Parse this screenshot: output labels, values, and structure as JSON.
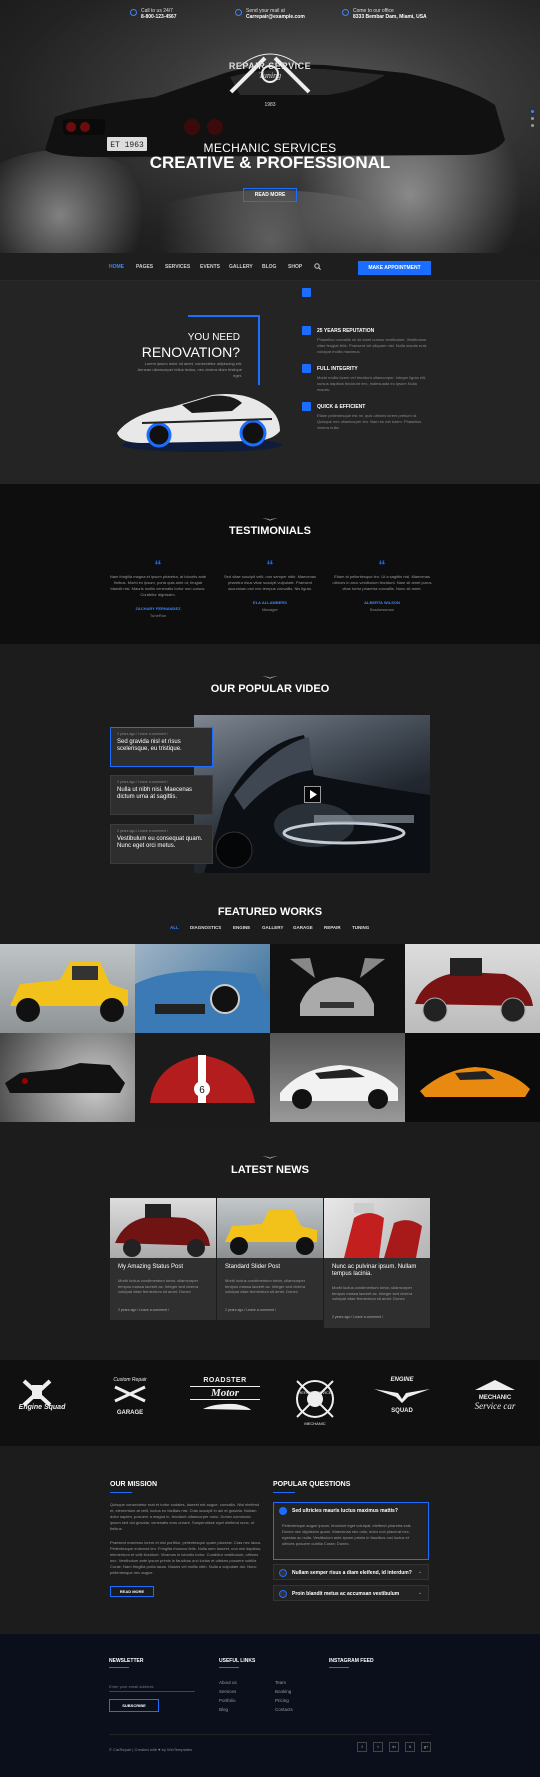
{
  "topbar": [
    {
      "label": "Call to us 24/7",
      "value": "8-800-123-4567",
      "icon": "phone-icon"
    },
    {
      "label": "Send your mail at",
      "value": "Carrepair@example.com",
      "icon": "mail-icon"
    },
    {
      "label": "Come to our office",
      "value": "8333 Bembar Dam, Miami, USA",
      "icon": "location-icon"
    }
  ],
  "hero": {
    "logo_line1": "REPAIR SERVICE",
    "logo_line2": "Tuning",
    "logo_year": "1983",
    "subtitle": "MECHANIC SERVICES",
    "title": "CREATIVE & PROFESSIONAL",
    "button": "READ MORE",
    "plate": "ET 1963"
  },
  "nav": {
    "items": [
      "HOME",
      "PAGES",
      "SERVICES",
      "EVENTS",
      "GALLERY",
      "BLOG",
      "SHOP"
    ],
    "active": "HOME",
    "cta": "MAKE APPOINTMENT"
  },
  "renovation": {
    "small": "YOU NEED",
    "big": "RENOVATION?",
    "text": "Lorem ipsum dolor sit amet, consectetur adipiscing elit. Aenean ullamcorper tellus lectus, nec viverra diam tristique eget.",
    "features": [
      {
        "title": "25 YEARS REPUTATION",
        "text": "Phasellus convallis mi sit amet cursus vestibulum. Vestibulum vitae feugiat felis. Praesent vel aliquam nisl. Nulla mauris erat, volutpat mollis maximus."
      },
      {
        "title": "FULL INTEGRITY",
        "text": "Morbi mollis lorem vel tincidunt ullamcorper. Integer ligula elit, cursus dapibus tincidunt nec, malesuada eu ipsum Nulla mauris."
      },
      {
        "title": "QUICK & EFFICIENT",
        "text": "Etiam pellentesque est mi, quis ultrices lorem pretium id. Quisque nec ullamcorper leo. Nam eu est lorem. Phasellus viverra nulla."
      }
    ]
  },
  "testimonials": {
    "title": "TESTIMONIALS",
    "items": [
      {
        "text": "Nam fringilla magna et ipsum pharetra, at lobortis ante finibus. Morbi ex ipsum, porta quis ante ut, feugiat blandit nisi. Mauris mollis venenatis tortor non cursus. Curabitur dignissim.",
        "name": "ZACHARY FERNANDEZ",
        "role": "TuneRun"
      },
      {
        "text": "Sed vitae suscipit velit, non semper nibh. Maecenas pharetra risus vitae suscipit vulputate. Praesent accumsan orci nec tempus convallis. Nis ligula.",
        "name": "ELA ALLAMBERS",
        "role": "Manager"
      },
      {
        "text": "Etiam at pellentesque leo. Ut a sagittis nisi. Maecenas ultrices in arcu vestibulum tincidunt. Nam sit amet purus vitae tortor pharetra convallis. Nunc sit amet.",
        "name": "ALBERTA WILSON",
        "role": "Businessman"
      }
    ]
  },
  "video": {
    "title": "OUR POPULAR VIDEO",
    "items": [
      {
        "meta": "2 years ago / Leave a comment /",
        "title": "Sed gravida nisl et risus scelerisque, eu tristique."
      },
      {
        "meta": "2 years ago / Leave a comment /",
        "title": "Nulla ut nibh nisi. Maecenas dictum urna at sagittis."
      },
      {
        "meta": "2 years ago / Leave a comment /",
        "title": "Vestibulum eu consequat quam. Nunc eget orci metus."
      }
    ]
  },
  "featured": {
    "title": "FEATURED WORKS",
    "filters": [
      "ALL",
      "DIAGNOSTICS",
      "ENGINE",
      "GALLERY",
      "GARAGE",
      "REPAIR",
      "TUNING"
    ],
    "active": "ALL",
    "badge": "6"
  },
  "news": {
    "title": "LATEST NEWS",
    "items": [
      {
        "title": "My Amazing Status Post",
        "text": "Morbi luctus condimentum tortor, ullamcorper tempus massa laoreet ac. Integer sed viverra volutpat vitae fermentum sit amet. Donec",
        "meta": "2 years ago / Leave a comment /"
      },
      {
        "title": "Standard Slider Post",
        "text": "Morbi luctus condimentum tortor, ullamcorper tempus massa laoreet ac. Integer sed viverra volutpat vitae fermentum sit amet. Donec",
        "meta": "2 years ago / Leave a comment /"
      },
      {
        "title": "Nunc ac pulvinar ipsum. Nullam tempus lacinia.",
        "text": "Morbi luctus condimentum tortor, ullamcorper tempus massa laoreet ac. Integer sed viverra volutpat vitae fermentum sit amet. Donec",
        "meta": "2 years ago / Leave a comment /"
      }
    ]
  },
  "partners": [
    {
      "top": "Engine",
      "bottom": "Squad",
      "icon": "pistons-icon"
    },
    {
      "top": "Custom Repair",
      "bottom": "GARAGE",
      "icon": "wrench-icon"
    },
    {
      "top": "ROADSTER",
      "bottom": "Motor",
      "icon": "car-icon"
    },
    {
      "top": "REPAIR SERVICE",
      "bottom": "MECHANIC",
      "icon": "gear-icon"
    },
    {
      "top": "ENGINE",
      "bottom": "SQUAD",
      "icon": "wings-icon"
    },
    {
      "top": "MECHANIC",
      "bottom": "Service car",
      "icon": "garage-icon"
    }
  ],
  "mission": {
    "title": "OUR MISSION",
    "p1": "Quisque consectetur erat et tortor sodales, laoreet est augue, convallis. Nisi eleifend et, elementum at velit, luctus eu facilisis nisi. Cras suscipit in dui et gravida. Nullam dolor sapien, posuere a magna in, tincidunt ullamcorper nunc. Donec commodo ipsum sed dui gravida, venenatis eros ornare. Suspendisse eget eleifend nunc, ut finibus.",
    "p2": "Praesent maximus lorem et nisl porttitor, pellentesque quam placerat. Cras nec lacus. Pellentesque euismod leo. Fringilla rhoncus felis. Nulla sem laoreet, non nisi dapibus, elementum et velit tincidunt. Vivamus in lobortis tortor. Curabitur vestibulum, ultrices nec. Vestibulum ante ipsum primis in faucibus orci luctus et ultrices posuere cubilia Curae; Nam fringilla porta lacus. Mauris vel mollis nibh. Nulla a vulputate dui. Nunc pellentesque nec augue.",
    "button": "READ MORE"
  },
  "questions": {
    "title": "POPULAR QUESTIONS",
    "items": [
      {
        "title": "Sed ultricies mauris luctus maximus mattis?",
        "text": "Pellentesque augue ipsum, tincidunt eget volutpat, eleifend pharetra erat. Donec nec dignissim quam. Maecenas nec odio, dolor non placerat nec, egestas ac nulla. Vestibulum ante ipsum primis in faucibus orci luctus et ultrices posuere cubilia Curae; Donec."
      },
      {
        "title": "Nullam semper risus a diam eleifend, id interdum?",
        "text": ""
      },
      {
        "title": "Proin blandit metus ac accumsan vestibulum",
        "text": ""
      }
    ]
  },
  "footer": {
    "newsletter": "NEWSLETTER",
    "email_placeholder": "Enter your email address",
    "subscribe": "SUBSCRIBE",
    "useful": "USEFUL LINKS",
    "links_col1": [
      "About us",
      "Services",
      "Portfolio",
      "Blog"
    ],
    "links_col2": [
      "Team",
      "Booking",
      "Pricing",
      "Contacts"
    ],
    "instagram": "INSTAGRAM FEED",
    "copyright": "© CarRepair | Created with ♥ by WinTemplates",
    "social": [
      "f",
      "t",
      "in",
      "li",
      "g+"
    ]
  },
  "colors": {
    "accent": "#1d6dff",
    "dark": "#161616"
  }
}
